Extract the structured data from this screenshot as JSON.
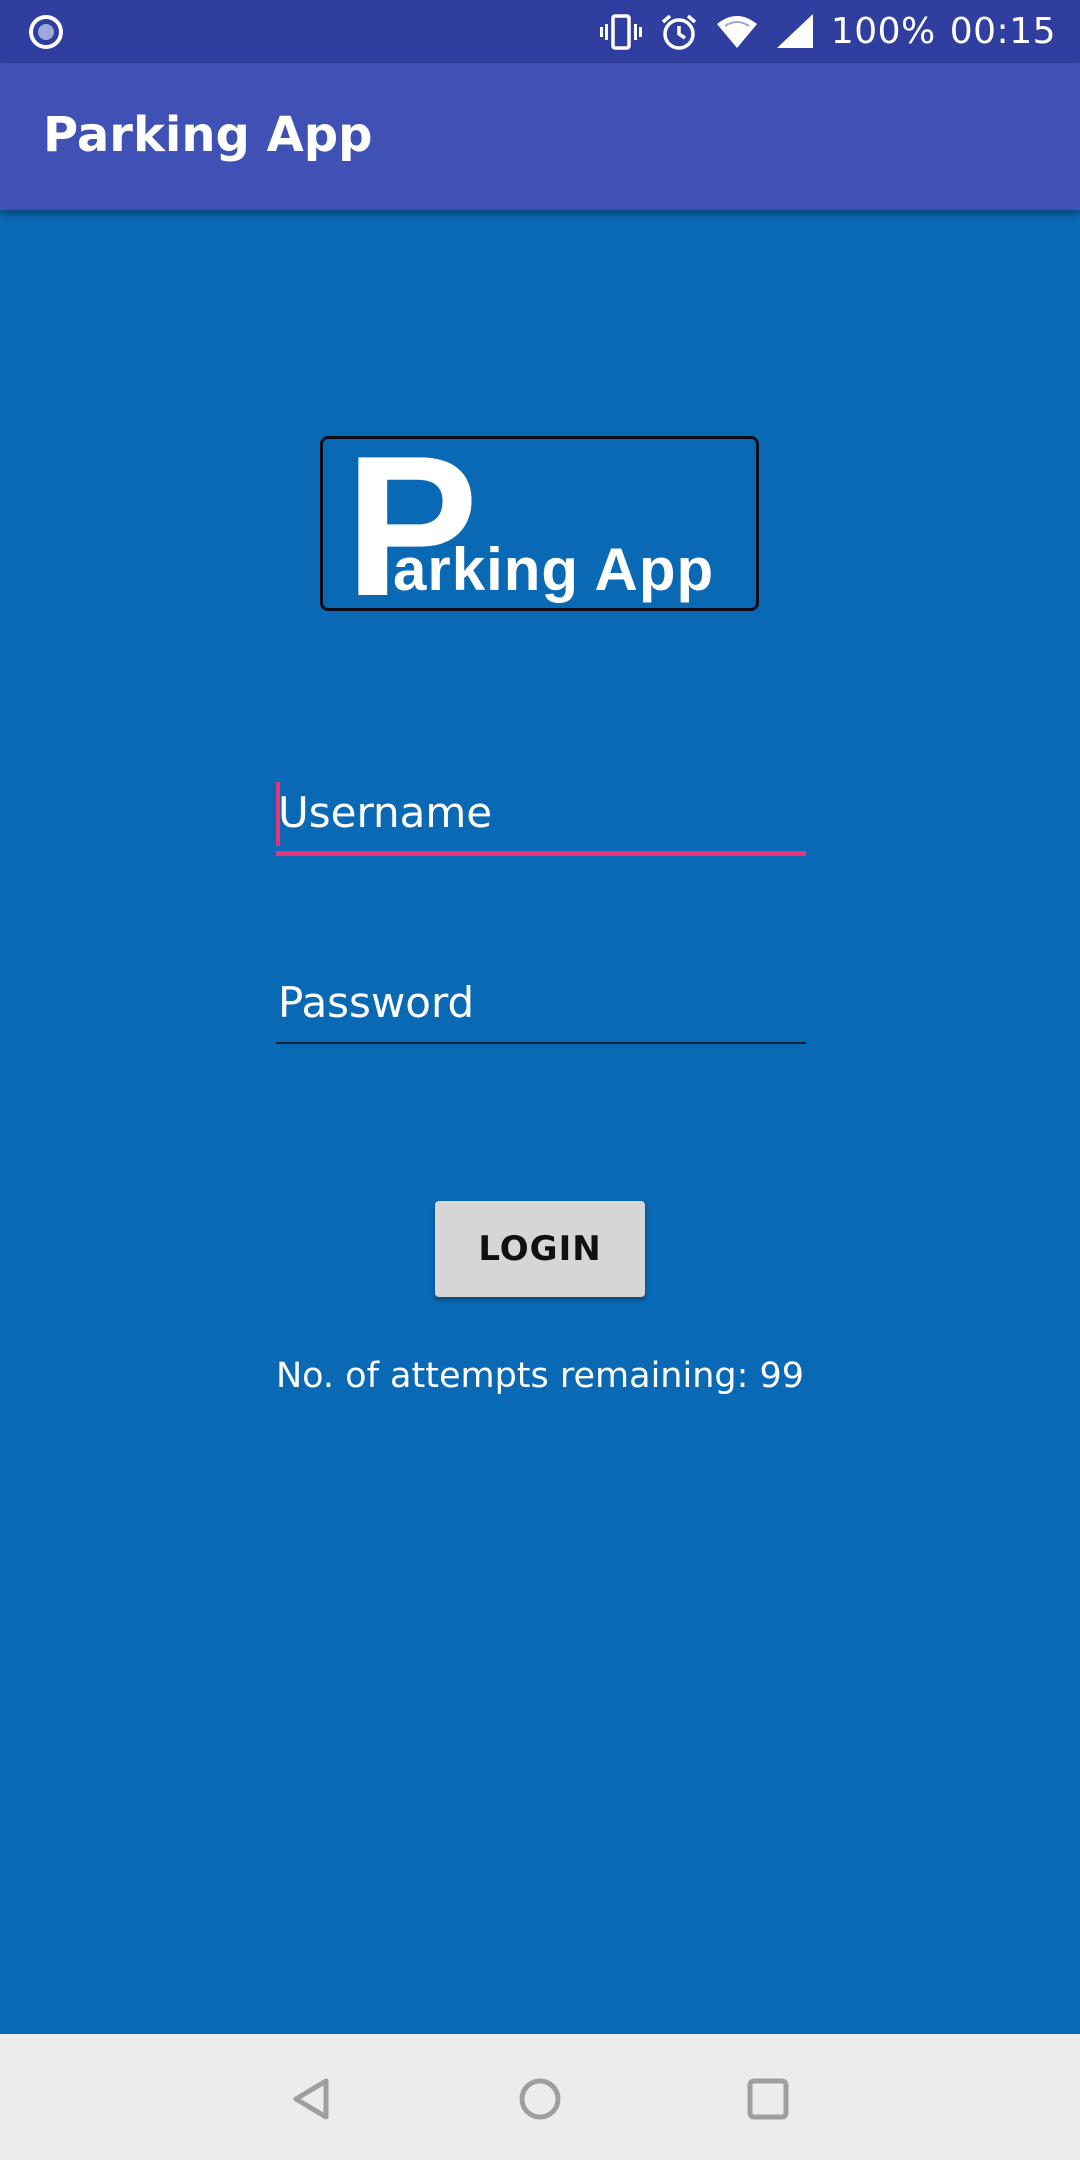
{
  "status_bar": {
    "battery_text": "100%",
    "time": "00:15",
    "icons": [
      "notification-dot-icon",
      "vibrate-icon",
      "alarm-icon",
      "wifi-icon",
      "signal-icon"
    ]
  },
  "app_bar": {
    "title": "Parking App"
  },
  "logo": {
    "text": "Parking App"
  },
  "login_form": {
    "username_placeholder": "Username",
    "username_value": "",
    "password_placeholder": "Password",
    "password_value": "",
    "login_label": "LOGIN",
    "attempts_text": "No. of attempts remaining: 99"
  },
  "nav_bar": {
    "icons": [
      "back-icon",
      "home-icon",
      "recents-icon"
    ]
  },
  "colors": {
    "background": "#0a69b4",
    "status_bar": "#303f9f",
    "app_bar": "#3f51b5",
    "accent": "#e8357a",
    "button": "#d6d6d6",
    "nav_bar": "#ececec"
  }
}
